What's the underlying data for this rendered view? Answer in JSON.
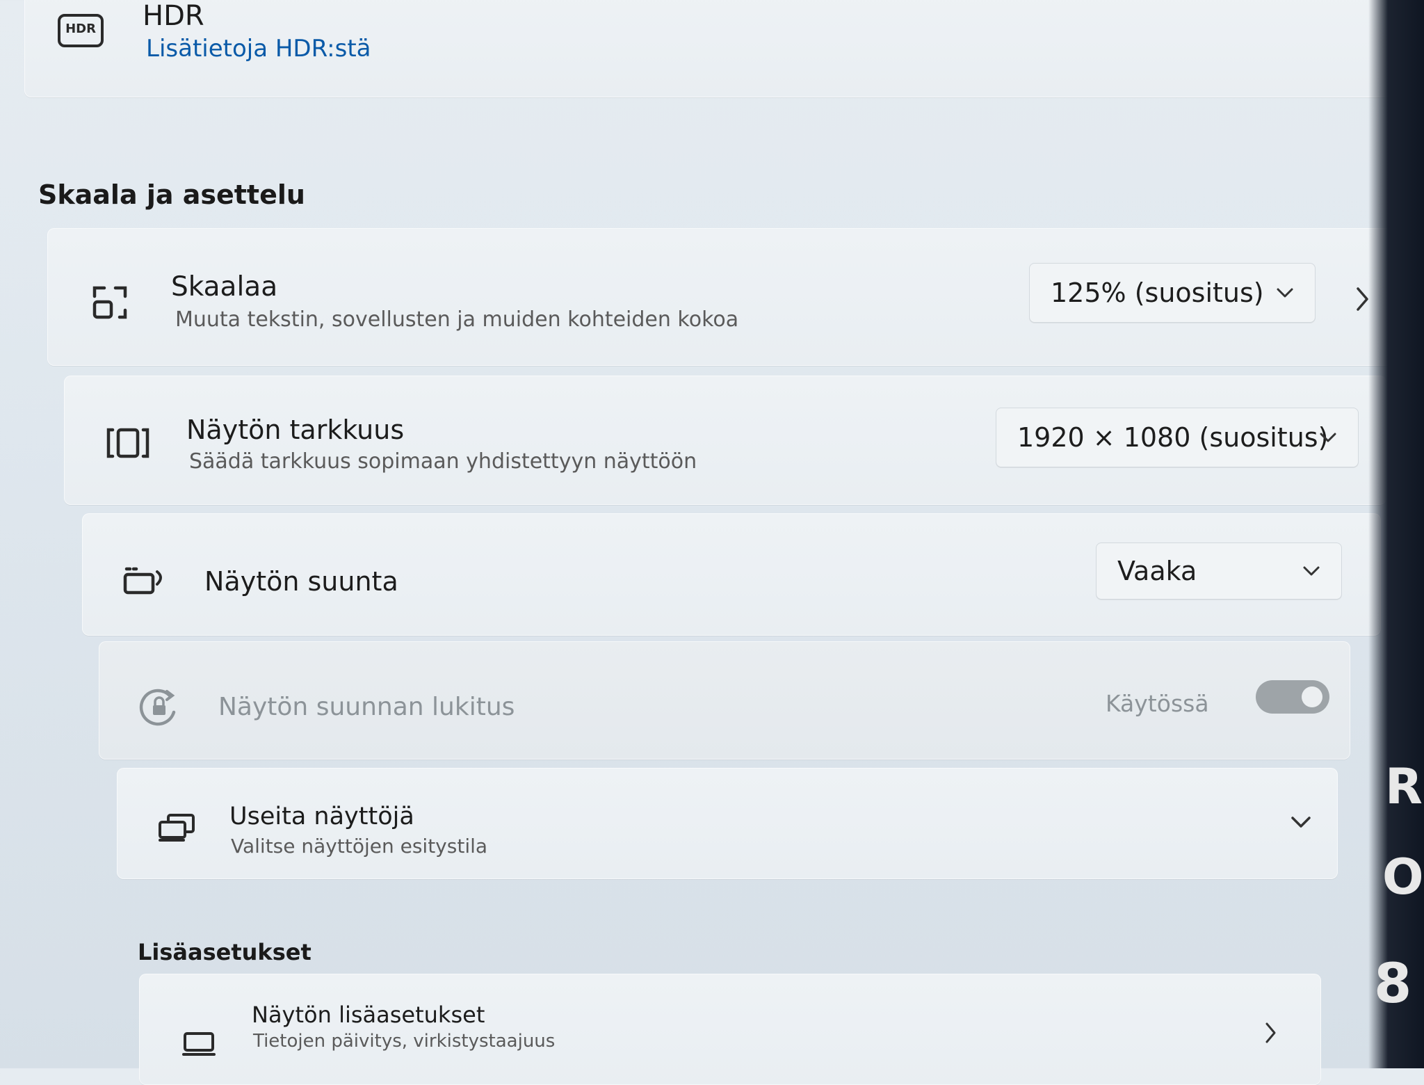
{
  "hdr": {
    "icon": "hdr-icon",
    "icon_text": "HDR",
    "title": "HDR",
    "link": "Lisätietoja HDR:stä"
  },
  "section": {
    "title": "Skaala ja asettelu"
  },
  "scale": {
    "icon": "scale-icon",
    "title": "Skaalaa",
    "subtitle": "Muuta tekstin, sovellusten ja muiden kohteiden kokoa",
    "value": "125% (suositus)"
  },
  "resolution": {
    "icon": "resolution-icon",
    "title": "Näytön tarkkuus",
    "subtitle": "Säädä tarkkuus sopimaan yhdistettyyn näyttöön",
    "value": "1920 × 1080 (suositus)"
  },
  "orientation": {
    "icon": "orientation-icon",
    "title": "Näytön suunta",
    "value": "Vaaka"
  },
  "rotation_lock": {
    "icon": "rotation-lock-icon",
    "title": "Näytön suunnan lukitus",
    "state_label": "Käytössä",
    "enabled": true,
    "disabled": true
  },
  "multiple_displays": {
    "icon": "multiple-displays-icon",
    "title": "Useita näyttöjä",
    "subtitle": "Valitse näyttöjen esitystila"
  },
  "advanced_section": {
    "title": "Lisäasetukset"
  },
  "advanced_display": {
    "icon": "monitor-icon",
    "title": "Näytön lisäasetukset",
    "subtitle": "Tietojen päivitys, virkistystaajuus"
  },
  "bezel_glyphs": [
    "R",
    "O",
    "8"
  ]
}
